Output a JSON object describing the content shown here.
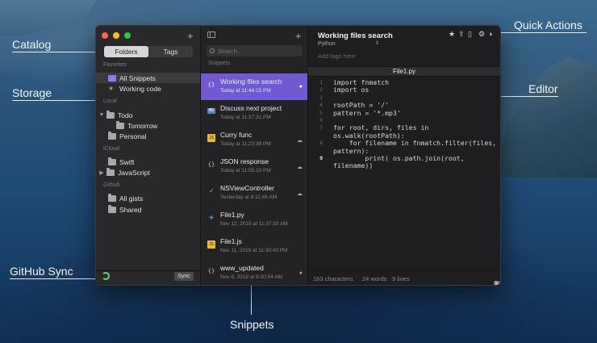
{
  "labels": {
    "catalog": "Catalog",
    "storage": "Storage",
    "github_sync": "GitHub Sync",
    "snippets": "Snippets",
    "quick_actions": "Quick Actions",
    "editor": "Editor"
  },
  "catalog": {
    "tabs": [
      "Folders",
      "Tags"
    ],
    "active_tab": "Folders",
    "favorites_label": "Favorites",
    "favorites": [
      "All Snippets",
      "Working code"
    ],
    "local_label": "Local",
    "local": [
      "Todo",
      "Tomorrow",
      "Personal"
    ],
    "icloud_label": "iCloud",
    "icloud": [
      "Swift",
      "JavaScript"
    ],
    "github_label": "Github",
    "github": [
      "All gists",
      "Shared"
    ],
    "sync_label": "Sync"
  },
  "snippets": {
    "search_placeholder": "Search...",
    "section_label": "Snippets",
    "items": [
      {
        "title": "Working files search",
        "date": "Today at 11:44:15 PM",
        "icon": "{}"
      },
      {
        "title": "Discuss next project",
        "date": "Today at 11:37:31 PM",
        "icon": "MD"
      },
      {
        "title": "Curry func",
        "date": "Today at 11:23:38 PM",
        "icon": "JS"
      },
      {
        "title": "JSON response",
        "date": "Today at 11:05:10 PM",
        "icon": "{}"
      },
      {
        "title": "NSViewController",
        "date": "Yesterday at 8:11:46 AM",
        "icon": "swift"
      },
      {
        "title": "File1.py",
        "date": "Nov 12, 2019 at 11:37:33 AM",
        "icon": "py"
      },
      {
        "title": "File1.js",
        "date": "Nov 11, 2019 at 11:30:43 PM",
        "icon": "JS"
      },
      {
        "title": "www_updated",
        "date": "Nov 6, 2019 at 8:20:54 AM",
        "icon": "{}"
      }
    ]
  },
  "editor": {
    "title": "Working files search",
    "language": "Python",
    "tags_placeholder": "Add tags here",
    "file_name": "File1.py",
    "code": [
      {
        "n": "1",
        "t": "import fnmatch"
      },
      {
        "n": "2",
        "t": "import os"
      },
      {
        "n": "3",
        "t": ""
      },
      {
        "n": "4",
        "t": "rootPath = '/'"
      },
      {
        "n": "5",
        "t": "pattern = '*.mp3'"
      },
      {
        "n": "6",
        "t": ""
      },
      {
        "n": "7",
        "t": "for root, dirs, files in"
      },
      {
        "n": "",
        "t": "os.walk(rootPath):"
      },
      {
        "n": "8",
        "t": "    for filename in fnmatch.filter(files,"
      },
      {
        "n": "",
        "t": "pattern):"
      },
      {
        "n": "9",
        "t": "        print( os.path.join(root,"
      },
      {
        "n": "",
        "t": "filename))"
      }
    ],
    "current_line": "9",
    "stats": {
      "characters": "163 characters",
      "words": "24 words",
      "lines": "9 lines"
    },
    "copy_label": "Copy to clipboard"
  },
  "icons": [
    "plus-icon",
    "sidebar-toggle-icon",
    "search-icon",
    "star-icon",
    "share-icon",
    "trash-icon",
    "settings-icon",
    "appearance-icon",
    "sync-icon",
    "github-icon",
    "cloud-icon",
    "clipboard-icon"
  ],
  "colors": {
    "accent": "#7059d1",
    "sync_green": "#6bd36b"
  }
}
